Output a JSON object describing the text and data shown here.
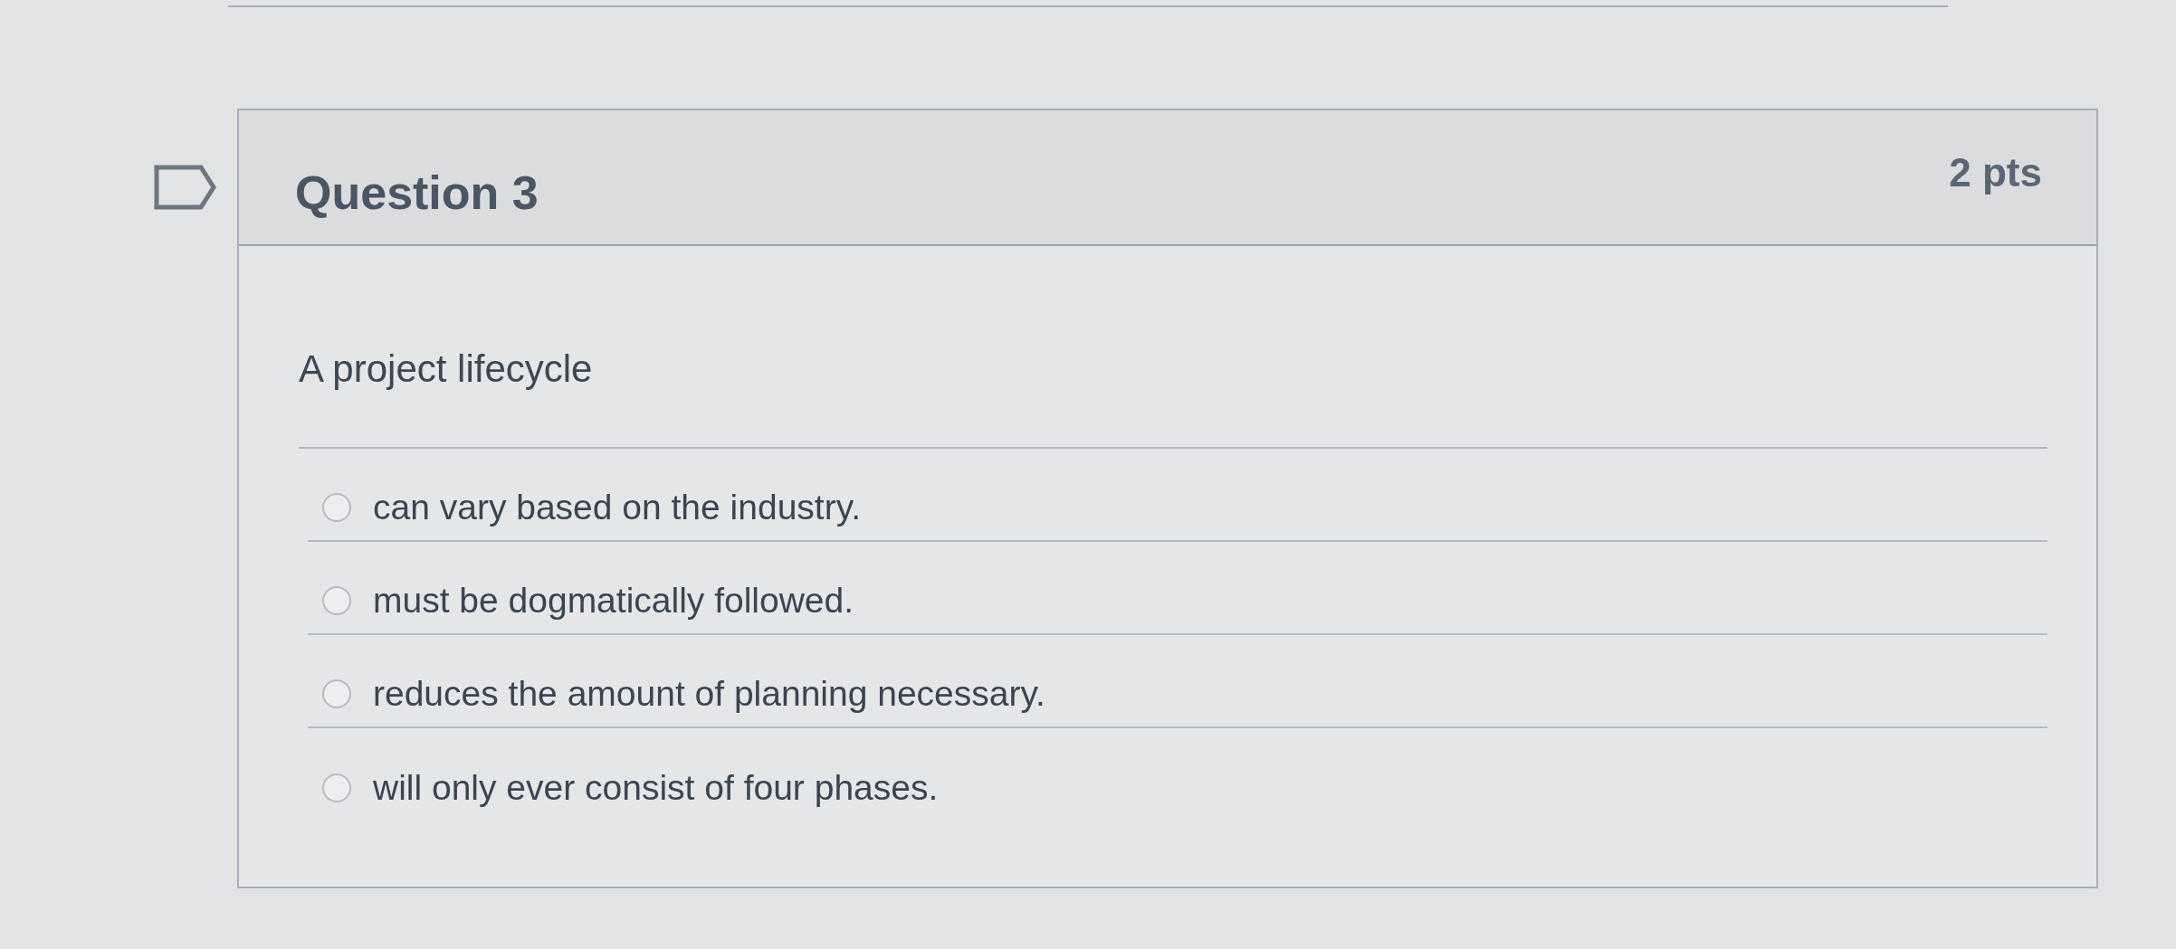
{
  "question": {
    "flagged": false,
    "title": "Question 3",
    "points": "2 pts",
    "prompt": "A project lifecycle",
    "options": [
      {
        "text": "can vary based on the industry.",
        "selected": false
      },
      {
        "text": "must be dogmatically followed.",
        "selected": false
      },
      {
        "text": "reduces the amount of planning necessary.",
        "selected": false
      },
      {
        "text": "will only ever consist of four phases.",
        "selected": false
      }
    ]
  }
}
